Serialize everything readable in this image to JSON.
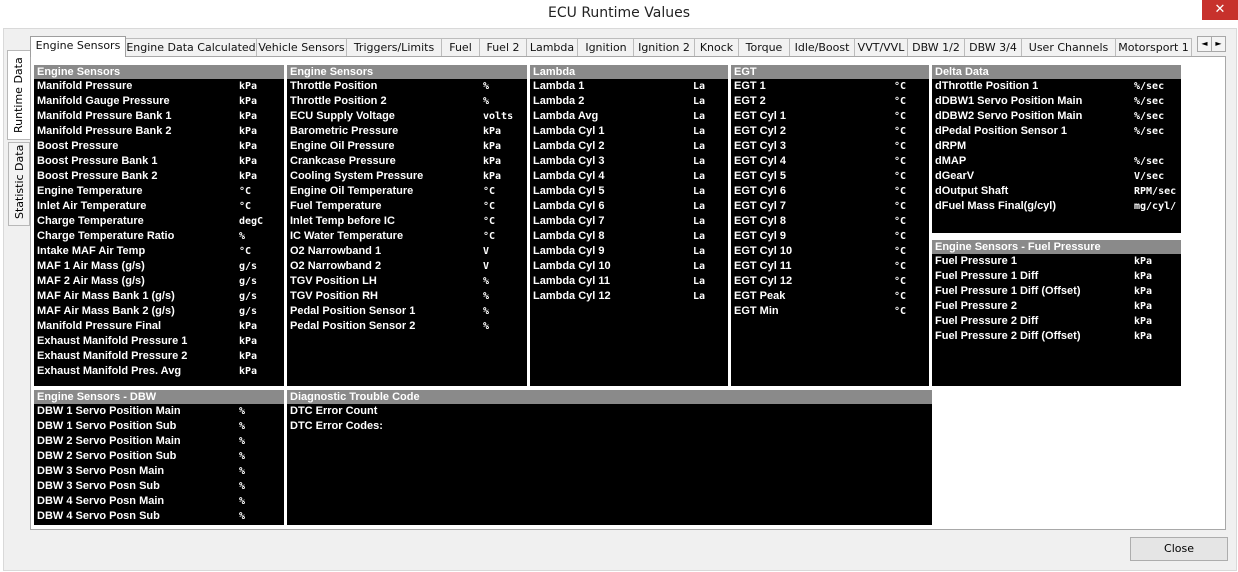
{
  "window": {
    "title": "ECU Runtime Values",
    "close_label": "✕"
  },
  "side_tabs": [
    {
      "label": "Runtime Data",
      "active": true
    },
    {
      "label": "Statistic Data",
      "active": false
    }
  ],
  "tabs": [
    {
      "label": "Engine Sensors",
      "active": true
    },
    {
      "label": "Engine Data Calculated"
    },
    {
      "label": "Vehicle Sensors"
    },
    {
      "label": "Triggers/Limits"
    },
    {
      "label": "Fuel"
    },
    {
      "label": "Fuel 2"
    },
    {
      "label": "Lambda"
    },
    {
      "label": "Ignition"
    },
    {
      "label": "Ignition 2"
    },
    {
      "label": "Knock"
    },
    {
      "label": "Torque"
    },
    {
      "label": "Idle/Boost"
    },
    {
      "label": "VVT/VVL"
    },
    {
      "label": "DBW 1/2"
    },
    {
      "label": "DBW 3/4"
    },
    {
      "label": "User Channels"
    },
    {
      "label": "Motorsport 1"
    }
  ],
  "tab_scroll": {
    "left": "◄",
    "right": "►"
  },
  "panels": [
    {
      "title": "Engine Sensors",
      "rows": [
        [
          "Manifold Pressure",
          "kPa"
        ],
        [
          "Manifold Gauge Pressure",
          "kPa"
        ],
        [
          "Manifold Pressure Bank 1",
          "kPa"
        ],
        [
          "Manifold Pressure Bank 2",
          "kPa"
        ],
        [
          "Boost Pressure",
          "kPa"
        ],
        [
          "Boost Pressure Bank 1",
          "kPa"
        ],
        [
          "Boost Pressure Bank 2",
          "kPa"
        ],
        [
          "Engine Temperature",
          "°C"
        ],
        [
          "Inlet Air Temperature",
          "°C"
        ],
        [
          "Charge Temperature",
          "degC"
        ],
        [
          "Charge Temperature Ratio",
          "%"
        ],
        [
          "Intake MAF Air Temp",
          "°C"
        ],
        [
          "MAF 1 Air Mass (g/s)",
          "g/s"
        ],
        [
          "MAF 2 Air Mass (g/s)",
          "g/s"
        ],
        [
          "MAF Air Mass Bank 1 (g/s)",
          "g/s"
        ],
        [
          "MAF Air Mass Bank 2 (g/s)",
          "g/s"
        ],
        [
          "Manifold Pressure Final",
          "kPa"
        ],
        [
          "Exhaust Manifold Pressure 1",
          "kPa"
        ],
        [
          "Exhaust Manifold Pressure 2",
          "kPa"
        ],
        [
          "Exhaust Manifold Pres. Avg",
          "kPa"
        ]
      ]
    },
    {
      "title": "Engine Sensors",
      "rows": [
        [
          "Throttle Position",
          "%"
        ],
        [
          "Throttle Position 2",
          "%"
        ],
        [
          "ECU Supply Voltage",
          "volts"
        ],
        [
          "Barometric Pressure",
          "kPa"
        ],
        [
          "Engine Oil Pressure",
          "kPa"
        ],
        [
          "Crankcase Pressure",
          "kPa"
        ],
        [
          "Cooling System Pressure",
          "kPa"
        ],
        [
          "Engine Oil Temperature",
          "°C"
        ],
        [
          "Fuel Temperature",
          "°C"
        ],
        [
          "Inlet Temp before IC",
          "°C"
        ],
        [
          "IC Water Temperature",
          "°C"
        ],
        [
          "O2 Narrowband 1",
          "V"
        ],
        [
          "O2 Narrowband 2",
          "V"
        ],
        [
          "TGV Position LH",
          "%"
        ],
        [
          "TGV Position RH",
          "%"
        ],
        [
          "Pedal Position Sensor 1",
          "%"
        ],
        [
          "Pedal Position Sensor  2",
          "%"
        ]
      ]
    },
    {
      "title": "Lambda",
      "rows": [
        [
          "Lambda 1",
          "La"
        ],
        [
          "Lambda 2",
          "La"
        ],
        [
          "Lambda Avg",
          "La"
        ],
        [
          "Lambda Cyl 1",
          "La"
        ],
        [
          "Lambda Cyl 2",
          "La"
        ],
        [
          "Lambda Cyl 3",
          "La"
        ],
        [
          "Lambda Cyl 4",
          "La"
        ],
        [
          "Lambda Cyl 5",
          "La"
        ],
        [
          "Lambda Cyl 6",
          "La"
        ],
        [
          "Lambda Cyl 7",
          "La"
        ],
        [
          "Lambda Cyl 8",
          "La"
        ],
        [
          "Lambda Cyl 9",
          "La"
        ],
        [
          "Lambda Cyl 10",
          "La"
        ],
        [
          "Lambda Cyl 11",
          "La"
        ],
        [
          "Lambda Cyl 12",
          "La"
        ]
      ]
    },
    {
      "title": "EGT",
      "rows": [
        [
          "EGT 1",
          "°C"
        ],
        [
          "EGT 2",
          "°C"
        ],
        [
          "EGT Cyl 1",
          "°C"
        ],
        [
          "EGT Cyl 2",
          "°C"
        ],
        [
          "EGT Cyl 3",
          "°C"
        ],
        [
          "EGT Cyl 4",
          "°C"
        ],
        [
          "EGT Cyl 5",
          "°C"
        ],
        [
          "EGT Cyl 6",
          "°C"
        ],
        [
          "EGT Cyl 7",
          "°C"
        ],
        [
          "EGT Cyl 8",
          "°C"
        ],
        [
          "EGT Cyl 9",
          "°C"
        ],
        [
          "EGT Cyl 10",
          "°C"
        ],
        [
          "EGT Cyl 11",
          "°C"
        ],
        [
          "EGT Cyl 12",
          "°C"
        ],
        [
          "EGT Peak",
          "°C"
        ],
        [
          "EGT Min",
          "°C"
        ]
      ]
    },
    {
      "title": "Delta Data",
      "rows": [
        [
          "dThrottle Position 1",
          "%/sec"
        ],
        [
          "dDBW1 Servo Position Main",
          "%/sec"
        ],
        [
          "dDBW2 Servo Position Main",
          "%/sec"
        ],
        [
          "dPedal Position Sensor 1",
          "%/sec"
        ],
        [
          "dRPM",
          ""
        ],
        [
          "dMAP",
          "%/sec"
        ],
        [
          "dGearV",
          "V/sec"
        ],
        [
          "dOutput Shaft",
          "RPM/sec"
        ],
        [
          "dFuel Mass Final(g/cyl)",
          "mg/cyl/"
        ]
      ]
    },
    {
      "title": "Engine Sensors - Fuel Pressure",
      "rows": [
        [
          "Fuel Pressure 1",
          "kPa"
        ],
        [
          "Fuel Pressure 1 Diff",
          "kPa"
        ],
        [
          "Fuel Pressure 1 Diff (Offset)",
          "kPa"
        ],
        [
          "Fuel Pressure 2",
          "kPa"
        ],
        [
          "Fuel Pressure 2 Diff",
          "kPa"
        ],
        [
          "Fuel Pressure 2 Diff (Offset)",
          "kPa"
        ]
      ]
    },
    {
      "title": "Engine Sensors - DBW",
      "rows": [
        [
          "DBW 1 Servo Position Main",
          "%"
        ],
        [
          "DBW 1 Servo Position Sub",
          "%"
        ],
        [
          "DBW 2 Servo Position Main",
          "%"
        ],
        [
          "DBW 2 Servo Position Sub",
          "%"
        ],
        [
          "DBW 3 Servo Posn Main",
          "%"
        ],
        [
          "DBW 3 Servo Posn Sub",
          "%"
        ],
        [
          "DBW 4 Servo Posn Main",
          "%"
        ],
        [
          "DBW 4 Servo Posn Sub",
          "%"
        ]
      ]
    },
    {
      "title": "Diagnostic Trouble Code",
      "rows": [
        [
          "DTC Error Count",
          ""
        ],
        [
          "DTC Error Codes:",
          ""
        ]
      ]
    }
  ],
  "footer": {
    "close_label": "Close"
  }
}
